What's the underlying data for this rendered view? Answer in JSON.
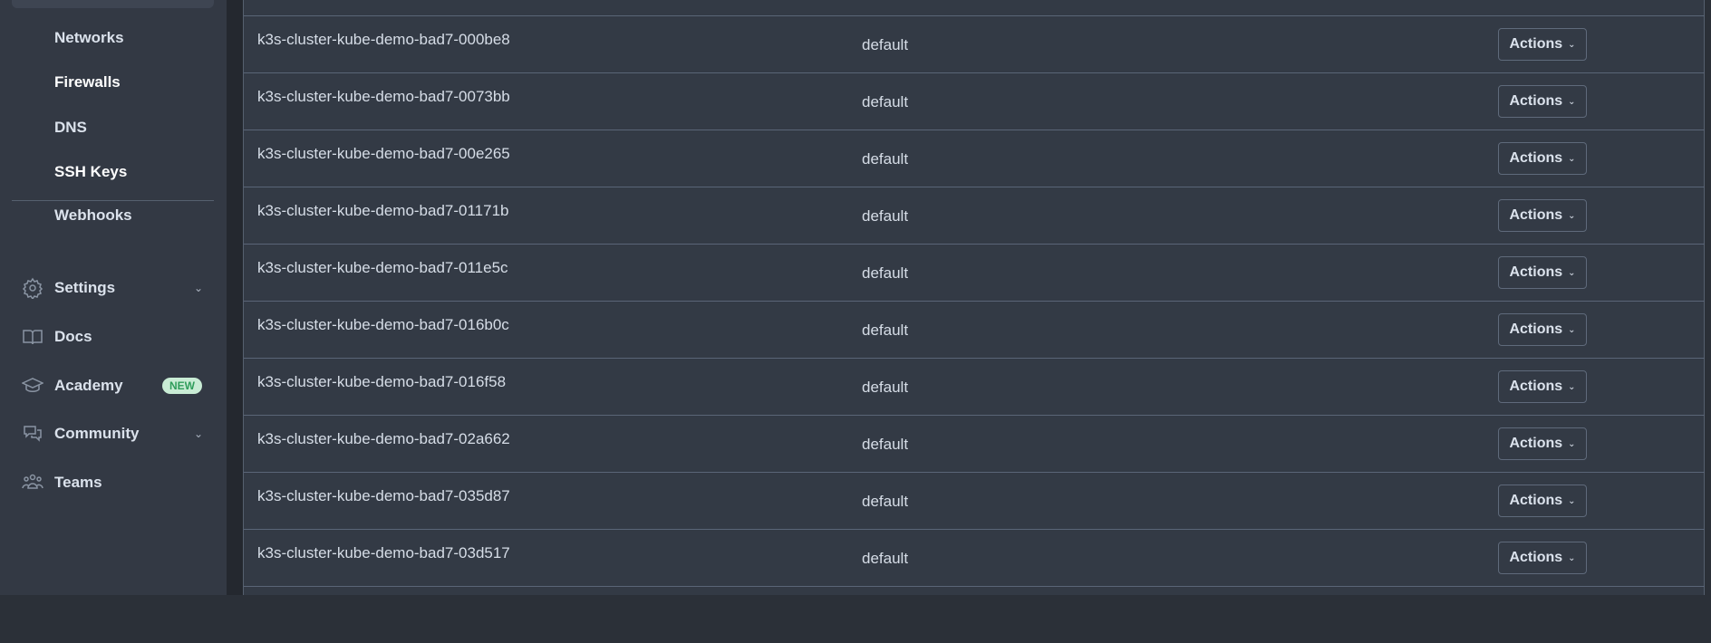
{
  "sidebar": {
    "sub_items": [
      "Networks",
      "Firewalls",
      "DNS",
      "SSH Keys",
      "Webhooks"
    ],
    "nav": [
      {
        "label": "Settings",
        "icon": "gear-icon",
        "chevron": true
      },
      {
        "label": "Docs",
        "icon": "book-icon"
      },
      {
        "label": "Academy",
        "icon": "graduation-cap-icon",
        "badge": "NEW"
      },
      {
        "label": "Community",
        "icon": "chat-bubbles-icon",
        "chevron": true
      },
      {
        "label": "Teams",
        "icon": "team-icon"
      }
    ]
  },
  "table": {
    "action_label": "Actions",
    "rows": [
      {
        "name": "k3s-cluster-kube-demo-bad7-000be8",
        "namespace": "default"
      },
      {
        "name": "k3s-cluster-kube-demo-bad7-0073bb",
        "namespace": "default"
      },
      {
        "name": "k3s-cluster-kube-demo-bad7-00e265",
        "namespace": "default"
      },
      {
        "name": "k3s-cluster-kube-demo-bad7-01171b",
        "namespace": "default"
      },
      {
        "name": "k3s-cluster-kube-demo-bad7-011e5c",
        "namespace": "default"
      },
      {
        "name": "k3s-cluster-kube-demo-bad7-016b0c",
        "namespace": "default"
      },
      {
        "name": "k3s-cluster-kube-demo-bad7-016f58",
        "namespace": "default"
      },
      {
        "name": "k3s-cluster-kube-demo-bad7-02a662",
        "namespace": "default"
      },
      {
        "name": "k3s-cluster-kube-demo-bad7-035d87",
        "namespace": "default"
      },
      {
        "name": "k3s-cluster-kube-demo-bad7-03d517",
        "namespace": "default"
      }
    ]
  }
}
